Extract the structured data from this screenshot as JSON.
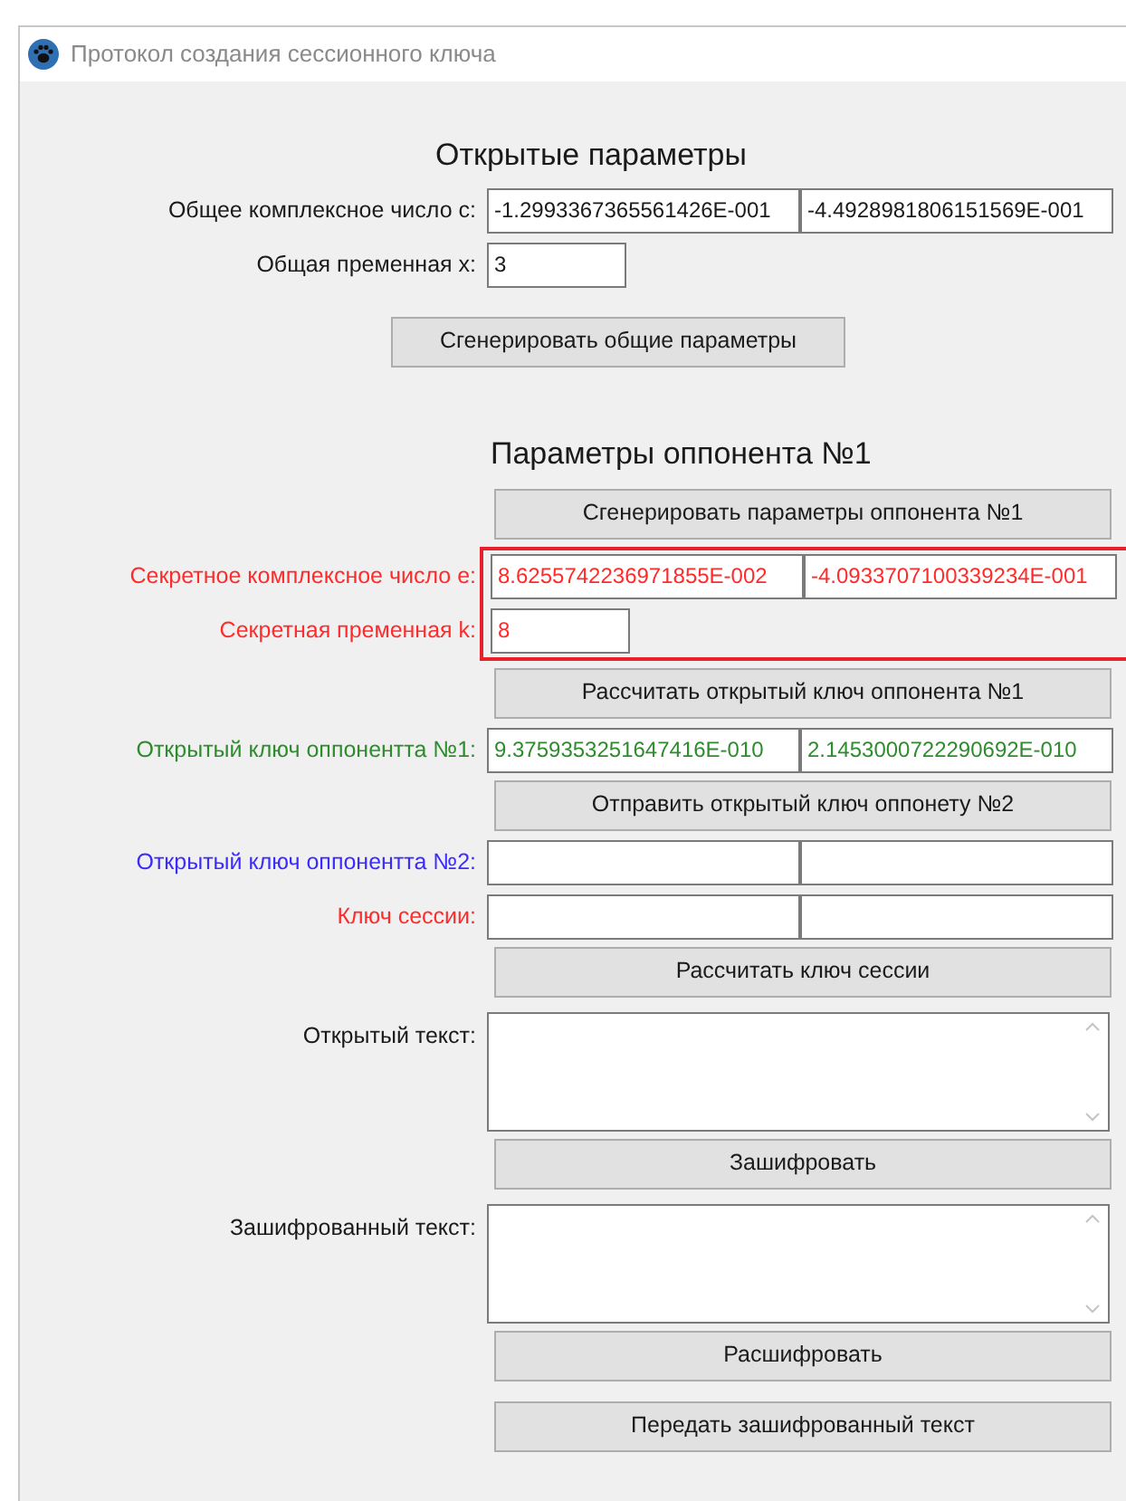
{
  "window": {
    "title": "Протокол создания сессионного ключа"
  },
  "sections": [
    {
      "kind": "common",
      "heading": "Открытые параметры",
      "items": [
        {
          "kind": "pair",
          "label": "Общее комплексное число c:",
          "values": [
            "-1.2993367365561426E-001",
            "-4.4928981806151569E-001"
          ]
        },
        {
          "kind": "single",
          "label": "Общая пременная x:",
          "value": "3"
        },
        {
          "kind": "button",
          "label": "Сгенерировать общие параметры"
        }
      ]
    },
    {
      "kind": "opponent",
      "heading": "Параметры оппонента №1",
      "items": [
        {
          "kind": "button",
          "label": "Сгенерировать параметры оппонента №1"
        },
        {
          "kind": "highlight",
          "rows": [
            {
              "kind": "pair",
              "label": "Секретное комплексное число e:",
              "values": [
                "8.6255742236971855E-002",
                "-4.0933707100339234E-001"
              ],
              "color": "#ff2b2b"
            },
            {
              "kind": "single",
              "label": "Секретная пременная k:",
              "value": "8",
              "color": "#ff2b2b"
            }
          ]
        },
        {
          "kind": "button",
          "label": "Рассчитать открытый ключ оппонента №1"
        },
        {
          "kind": "pair",
          "label": "Открытый ключ оппонентта №1:",
          "values": [
            "9.3759353251647416E-010",
            "2.1453000722290692E-010"
          ],
          "color": "#2e8b2e"
        },
        {
          "kind": "button",
          "label": "Отправить открытый ключ оппонету №2"
        },
        {
          "kind": "pair",
          "label": "Открытый ключ оппонентта №2:",
          "color": "#3b2bff"
        },
        {
          "kind": "pair",
          "label": "Ключ сессии:",
          "color": "#ff2b2b"
        },
        {
          "kind": "button",
          "label": "Рассчитать ключ сессии"
        },
        {
          "kind": "text",
          "label": "Открытый текст:"
        },
        {
          "kind": "button",
          "label": "Зашифровать"
        },
        {
          "kind": "text",
          "label": "Зашифрованный текст:"
        },
        {
          "kind": "button",
          "label": "Расшифровать"
        },
        {
          "kind": "button",
          "label": "Передать зашифрованный текст"
        }
      ]
    }
  ]
}
